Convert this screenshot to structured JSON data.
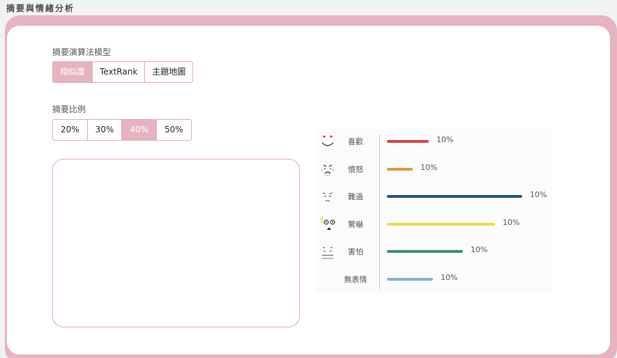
{
  "page": {
    "title": "摘要與情緒分析"
  },
  "algorithm": {
    "label": "摘要演算法模型",
    "options": [
      "相似度",
      "TextRank",
      "主題地圖"
    ],
    "selected": "相似度"
  },
  "ratio": {
    "label": "摘要比例",
    "options": [
      "20%",
      "30%",
      "40%",
      "50%"
    ],
    "selected": "40%"
  },
  "summary": {
    "text": ""
  },
  "emotions": [
    {
      "label": "喜歡",
      "percent": "10%",
      "color": "#d94040",
      "bar_fraction": 0.31,
      "icon": "heart-eyes-face-icon"
    },
    {
      "label": "憤怒",
      "percent": "10%",
      "color": "#e09a3a",
      "bar_fraction": 0.19,
      "icon": "angry-face-icon"
    },
    {
      "label": "難過",
      "percent": "10%",
      "color": "#24507f",
      "bar_fraction": 1.0,
      "icon": "sad-face-icon"
    },
    {
      "label": "驚嚇",
      "percent": "10%",
      "color": "#e6df4a",
      "bar_fraction": 0.8,
      "icon": "shocked-face-icon"
    },
    {
      "label": "害怕",
      "percent": "10%",
      "color": "#3a8c7c",
      "bar_fraction": 0.56,
      "icon": "scared-face-icon"
    },
    {
      "label": "無表情",
      "percent": "10%",
      "color": "#7fb3cf",
      "bar_fraction": 0.34,
      "icon": ""
    }
  ]
}
